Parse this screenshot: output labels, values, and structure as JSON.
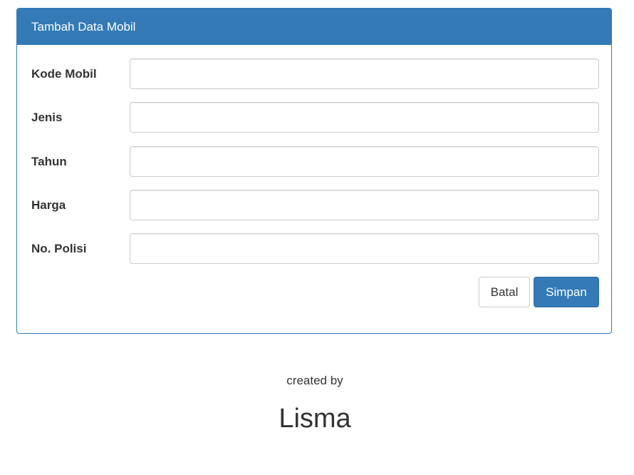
{
  "panel": {
    "title": "Tambah Data Mobil"
  },
  "form": {
    "fields": [
      {
        "label": "Kode Mobil",
        "value": "",
        "placeholder": ""
      },
      {
        "label": "Jenis",
        "value": "",
        "placeholder": ""
      },
      {
        "label": "Tahun",
        "value": "",
        "placeholder": ""
      },
      {
        "label": "Harga",
        "value": "",
        "placeholder": ""
      },
      {
        "label": "No. Polisi",
        "value": "",
        "placeholder": ""
      }
    ],
    "cancel_label": "Batal",
    "save_label": "Simpan"
  },
  "footer": {
    "caption": "created by",
    "author": "Lisma"
  },
  "colors": {
    "primary": "#337ab7",
    "border": "#cccccc",
    "text": "#333333"
  }
}
